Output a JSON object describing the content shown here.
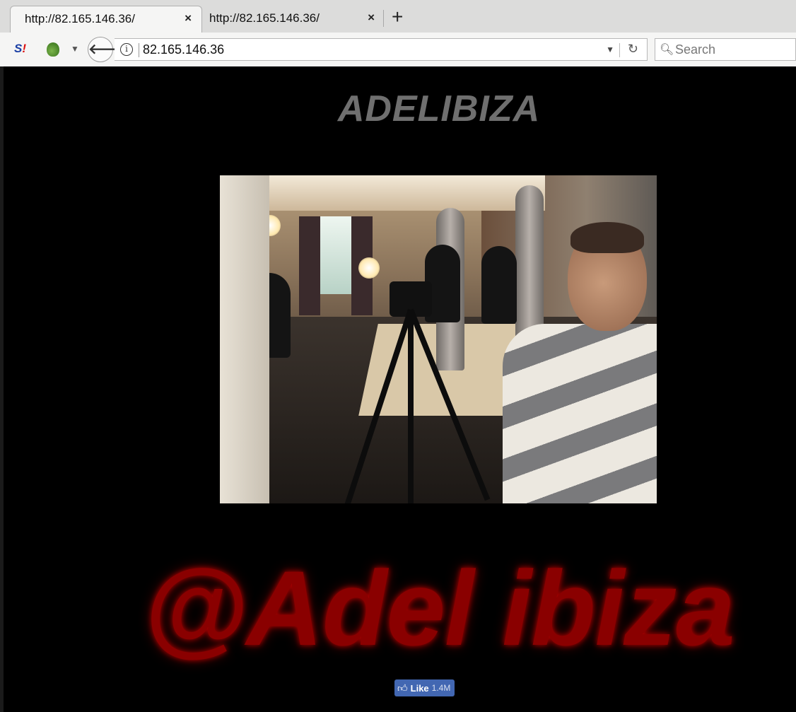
{
  "browser": {
    "tabs": [
      {
        "title": "http://82.165.146.36/",
        "close": "×"
      },
      {
        "title": "http://82.165.146.36/",
        "close": "×"
      }
    ],
    "new_tab": "+",
    "ext_label_a": "S",
    "ext_label_b": "!",
    "dropdown": "▼",
    "url": "82.165.146.36",
    "info": "i",
    "reload": "↻",
    "search_placeholder": "Search"
  },
  "page": {
    "title": "ADELIBIZA",
    "handle": "@Adel ibiza",
    "like": {
      "label": "Like",
      "count": "1.4M"
    }
  }
}
